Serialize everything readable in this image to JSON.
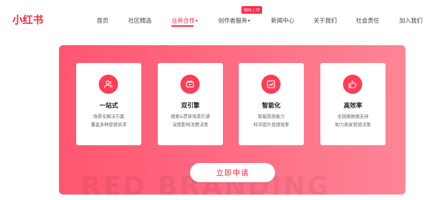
{
  "brand": {
    "logo_text": "小红书",
    "accent": "#ff2741"
  },
  "nav": {
    "items": [
      {
        "label": "首页"
      },
      {
        "label": "社区精选"
      },
      {
        "label": "业务合作",
        "caret": "▾"
      },
      {
        "label": "创作者服务",
        "caret": "▾"
      },
      {
        "label": "新闻中心"
      },
      {
        "label": "关于我们"
      },
      {
        "label": "社会责任"
      },
      {
        "label": "加入我们"
      }
    ],
    "active_index": 2,
    "badge": "限时上传"
  },
  "hero": {
    "cards": [
      {
        "title": "一站式",
        "desc1": "场景化解决方案",
        "desc2": "覆盖多种营销诉求",
        "icon": "users-icon"
      },
      {
        "title": "双引擎",
        "desc1": "搜索&贯穿场景打通",
        "desc2": "深度影响消费决策",
        "icon": "engine-icon"
      },
      {
        "title": "智能化",
        "desc1": "智能投放能力",
        "desc2": "科学提升营销效率",
        "icon": "chart-icon"
      },
      {
        "title": "高效率",
        "desc1": "全链路数据支持",
        "desc2": "助力商家营销决策",
        "icon": "thumbs-up-icon"
      }
    ],
    "apply_label": "立即申请",
    "watermark": "RED BRANDING"
  }
}
